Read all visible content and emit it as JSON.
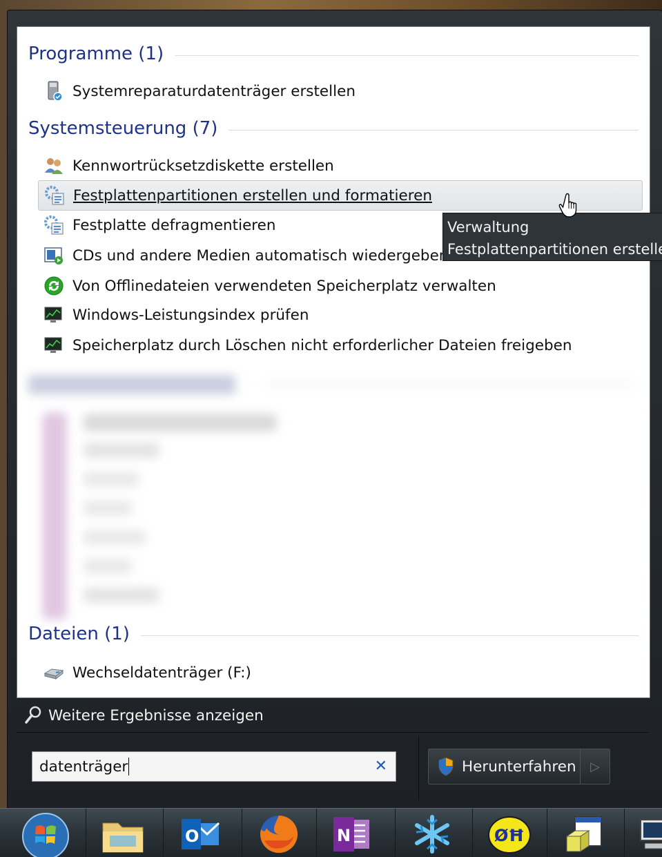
{
  "groups": {
    "programs": {
      "title": "Programme (1)",
      "items": [
        {
          "label": "Systemreparaturdatenträger erstellen",
          "icon": "disc-repair-icon"
        }
      ]
    },
    "control_panel": {
      "title": "Systemsteuerung (7)",
      "items": [
        {
          "label": "Kennwortrücksetzdiskette erstellen",
          "icon": "users-icon"
        },
        {
          "label": "Festplattenpartitionen erstellen und formatieren",
          "icon": "admin-tools-icon"
        },
        {
          "label": "Festplatte defragmentieren",
          "icon": "admin-tools-icon"
        },
        {
          "label": "CDs und andere Medien automatisch wiedergeben",
          "icon": "autoplay-icon"
        },
        {
          "label": "Von Offlinedateien verwendeten Speicherplatz verwalten",
          "icon": "sync-icon"
        },
        {
          "label": "Windows-Leistungsindex prüfen",
          "icon": "monitor-icon"
        },
        {
          "label": "Speicherplatz durch Löschen nicht erforderlicher Dateien freigeben",
          "icon": "monitor-icon"
        }
      ]
    },
    "files": {
      "title": "Dateien (1)",
      "items": [
        {
          "label": "Wechseldatenträger (F:)",
          "icon": "removable-drive-icon"
        }
      ]
    }
  },
  "tooltip": {
    "line1": "Verwaltung",
    "line2": "Festplattenpartitionen erstellen"
  },
  "more_results": "Weitere Ergebnisse anzeigen",
  "search": {
    "value": "datenträger"
  },
  "shutdown_label": "Herunterfahren",
  "taskbar": [
    "start-orb-icon",
    "explorer-icon",
    "outlook-icon",
    "firefox-icon",
    "onenote-icon",
    "snowflake-app-icon",
    "app-yellow-icon",
    "window-app-icon",
    "computer-icon"
  ],
  "colors": {
    "group_title": "#1e3287",
    "hover_bg": "#e6e9ec",
    "frame": "#23282c",
    "search_clear": "#1f5bb0"
  }
}
